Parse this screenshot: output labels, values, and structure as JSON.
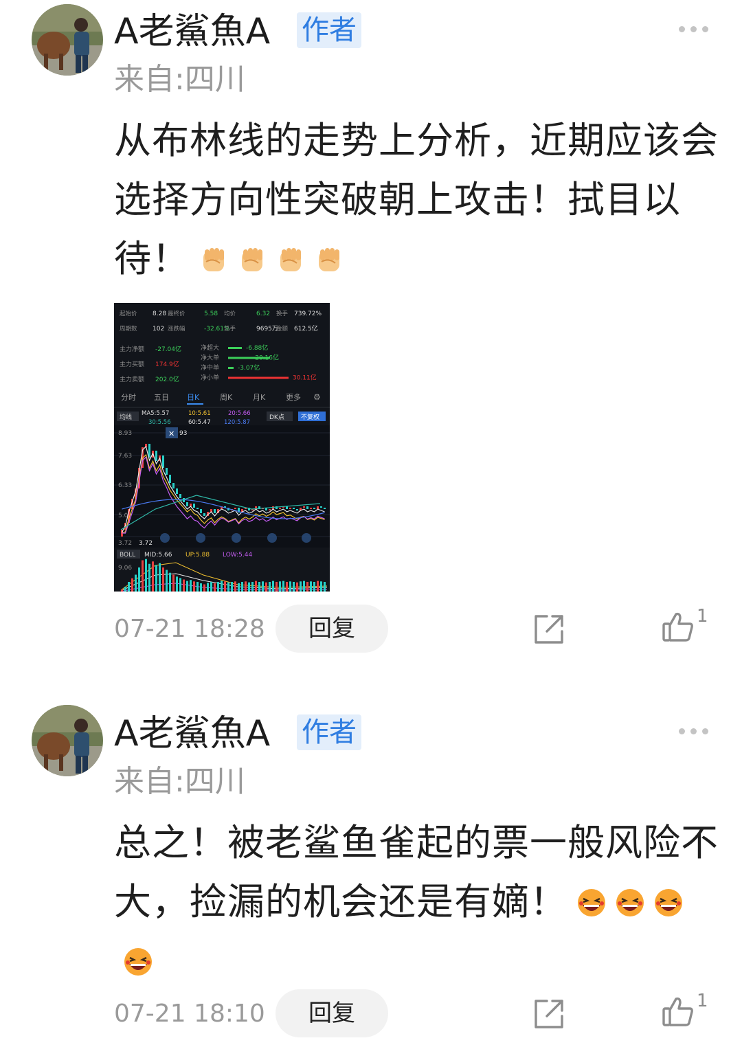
{
  "comments": [
    {
      "username": "A老鯊魚A",
      "badge": "作者",
      "location": "来自:四川",
      "text": "从布林线的走势上分析，近期应该会选择方向性突破朝上攻击！拭目以待！",
      "emoji": "fist-emoji",
      "emoji_count": 4,
      "timestamp": "07-21 18:28",
      "reply_label": "回复",
      "like_count": "1",
      "attachment": {
        "stats": {
          "row1": [
            [
              "起始价",
              "8.28"
            ],
            [
              "最终价",
              "5.58"
            ],
            [
              "均价",
              "6.32"
            ],
            [
              "换手",
              "739.72%"
            ]
          ],
          "row2": [
            [
              "周期数",
              "102"
            ],
            [
              "涨跌幅",
              "-32.61%"
            ],
            [
              "总手",
              "9695万"
            ],
            [
              "金额",
              "612.5亿"
            ]
          ]
        },
        "funds_left": [
          [
            "主力净额",
            "-27.04亿"
          ],
          [
            "主力买额",
            "174.9亿"
          ],
          [
            "主力卖额",
            "202.0亿"
          ]
        ],
        "funds_right": [
          [
            "净超大",
            "-6.88亿"
          ],
          [
            "净大单",
            "-20.16亿"
          ],
          [
            "净中单",
            "-3.07亿"
          ],
          [
            "净小单",
            "30.11亿"
          ]
        ],
        "tabs": [
          "分时",
          "五日",
          "日K",
          "周K",
          "月K",
          "更多"
        ],
        "active_tab": "日K",
        "ma_label": "均线",
        "ma": [
          "MA5:5.57",
          "10:5.61",
          "20:5.66",
          "30:5.56",
          "60:5.47",
          "120:5.87"
        ],
        "dk_label": "DK点",
        "fq_label": "不复权",
        "price_ticks": [
          "8.93",
          "7.63",
          "6.33",
          "5.02",
          "3.72"
        ],
        "high_marker": "93",
        "low_marker": "3.72",
        "boll": {
          "label": "BOLL",
          "mid": "MID:5.66",
          "up": "UP:5.88",
          "low": "LOW:5.44"
        },
        "boll_tick": "9.06"
      }
    },
    {
      "username": "A老鯊魚A",
      "badge": "作者",
      "location": "来自:四川",
      "text": "总之！被老鲨鱼雀起的票一般风险不大，捡漏的机会还是有嫡！",
      "emoji": "laughing-emoji",
      "emoji_count": 4,
      "timestamp": "07-21 18:10",
      "reply_label": "回复",
      "like_count": "1"
    }
  ],
  "colors": {
    "badge_text": "#2f7de1",
    "badge_bg": "#e3eefb",
    "muted": "#9a9a9a",
    "up": "#e33",
    "down": "#2ecc40"
  }
}
